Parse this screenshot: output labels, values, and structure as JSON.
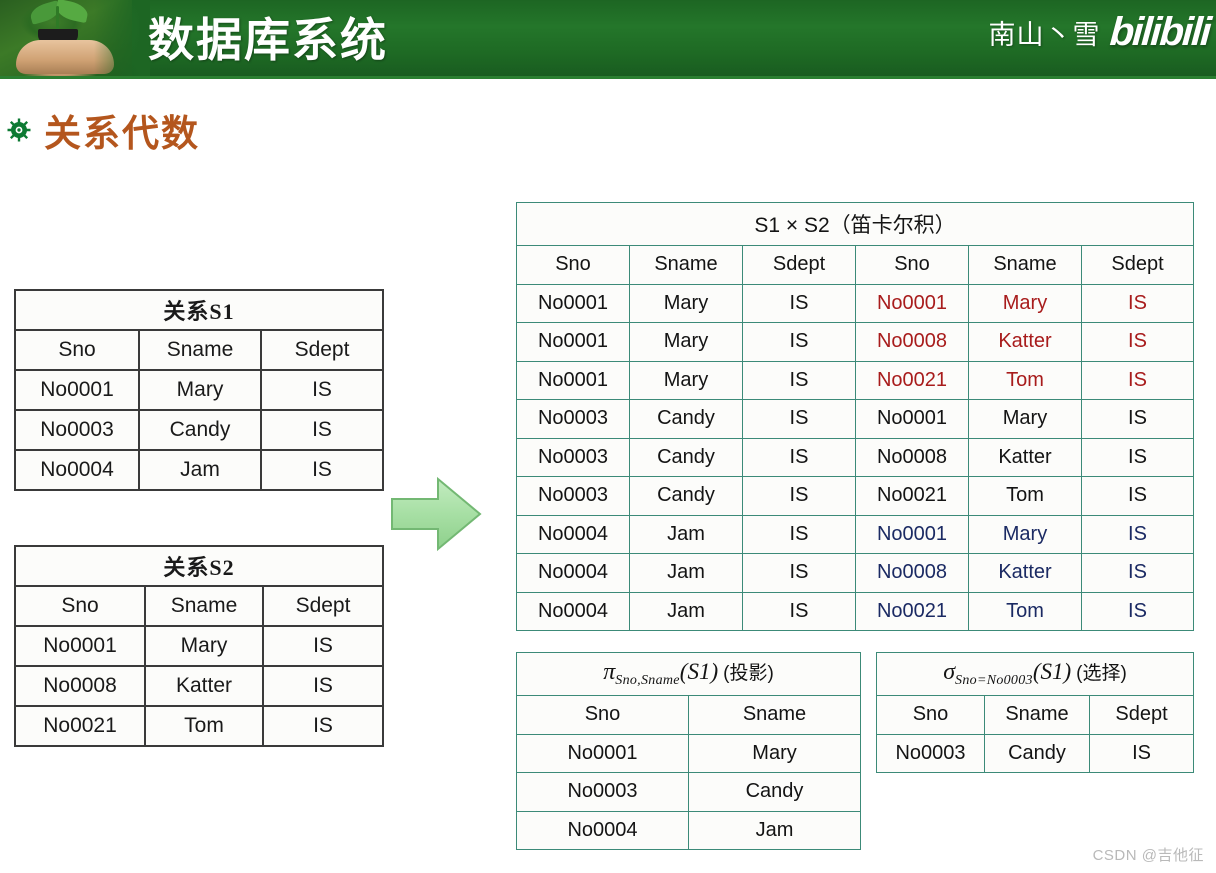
{
  "banner": {
    "title": "数据库系统",
    "uploader": "南山丶雪",
    "logo_text": "bilibili",
    "photo_alt": "hand-holding-seedling"
  },
  "section": {
    "bullet": "flower-bullet-icon",
    "title": "关系代数"
  },
  "arrow": {
    "name": "green-right-arrow",
    "color": "#a6dfa6"
  },
  "tables": {
    "s1": {
      "caption": "关系S1",
      "columns": [
        "Sno",
        "Sname",
        "Sdept"
      ],
      "rows": [
        [
          "No0001",
          "Mary",
          "IS"
        ],
        [
          "No0003",
          "Candy",
          "IS"
        ],
        [
          "No0004",
          "Jam",
          "IS"
        ]
      ]
    },
    "s2": {
      "caption": "关系S2",
      "columns": [
        "Sno",
        "Sname",
        "Sdept"
      ],
      "rows": [
        [
          "No0001",
          "Mary",
          "IS"
        ],
        [
          "No0008",
          "Katter",
          "IS"
        ],
        [
          "No0021",
          "Tom",
          "IS"
        ]
      ]
    },
    "product": {
      "caption": "S1 × S2（笛卡尔积）",
      "columns": [
        "Sno",
        "Sname",
        "Sdept",
        "Sno",
        "Sname",
        "Sdept"
      ],
      "rows": [
        {
          "cells": [
            "No0001",
            "Mary",
            "IS",
            "No0001",
            "Mary",
            "IS"
          ],
          "highlight": "red"
        },
        {
          "cells": [
            "No0001",
            "Mary",
            "IS",
            "No0008",
            "Katter",
            "IS"
          ],
          "highlight": "red"
        },
        {
          "cells": [
            "No0001",
            "Mary",
            "IS",
            "No0021",
            "Tom",
            "IS"
          ],
          "highlight": "red"
        },
        {
          "cells": [
            "No0003",
            "Candy",
            "IS",
            "No0001",
            "Mary",
            "IS"
          ],
          "highlight": "none"
        },
        {
          "cells": [
            "No0003",
            "Candy",
            "IS",
            "No0008",
            "Katter",
            "IS"
          ],
          "highlight": "none"
        },
        {
          "cells": [
            "No0003",
            "Candy",
            "IS",
            "No0021",
            "Tom",
            "IS"
          ],
          "highlight": "none"
        },
        {
          "cells": [
            "No0004",
            "Jam",
            "IS",
            "No0001",
            "Mary",
            "IS"
          ],
          "highlight": "blue"
        },
        {
          "cells": [
            "No0004",
            "Jam",
            "IS",
            "No0008",
            "Katter",
            "IS"
          ],
          "highlight": "blue"
        },
        {
          "cells": [
            "No0004",
            "Jam",
            "IS",
            "No0021",
            "Tom",
            "IS"
          ],
          "highlight": "blue"
        }
      ],
      "highlight_colors": {
        "red": "#a81c1c",
        "blue": "#1b2a63"
      }
    },
    "projection": {
      "caption": {
        "symbol": "π",
        "subscript": "Sno,Sname",
        "relation": "(S1)",
        "note": "(投影)"
      },
      "columns": [
        "Sno",
        "Sname"
      ],
      "rows": [
        [
          "No0001",
          "Mary"
        ],
        [
          "No0003",
          "Candy"
        ],
        [
          "No0004",
          "Jam"
        ]
      ]
    },
    "selection": {
      "caption": {
        "symbol": "σ",
        "subscript": "Sno=No0003",
        "relation": "(S1)",
        "note": "(选择)"
      },
      "columns": [
        "Sno",
        "Sname",
        "Sdept"
      ],
      "rows": [
        [
          "No0003",
          "Candy",
          "IS"
        ]
      ]
    }
  },
  "watermark": "CSDN @吉他征"
}
